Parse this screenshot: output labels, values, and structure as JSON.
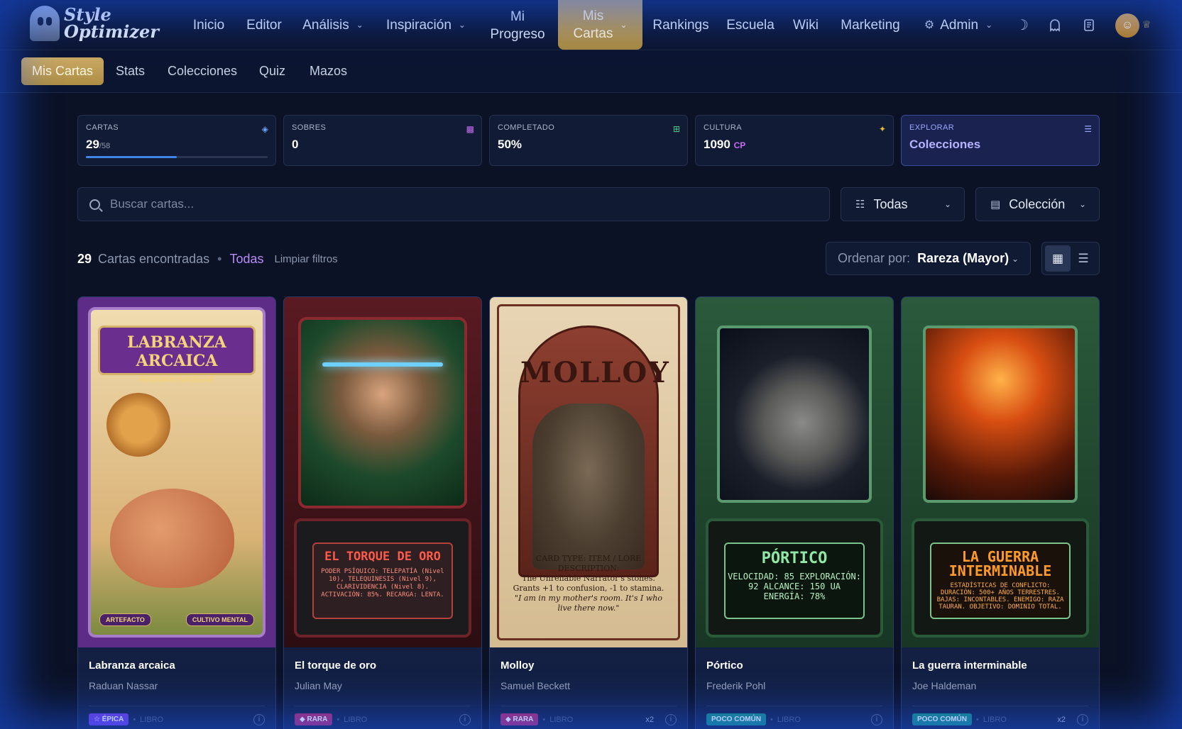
{
  "app": {
    "logo_line1": "Style",
    "logo_line2": "Optimizer"
  },
  "topnav": {
    "items": [
      "Inicio",
      "Editor",
      "Análisis",
      "Inspiración",
      "Mi Progreso",
      "Mis Cartas",
      "Rankings",
      "Escuela",
      "Wiki",
      "Marketing",
      "Admin"
    ],
    "mi_progreso_l1": "Mi",
    "mi_progreso_l2": "Progreso",
    "mis_cartas_l1": "Mis",
    "mis_cartas_l2": "Cartas",
    "icons": [
      "moon-icon",
      "ghost-icon",
      "notebook-icon",
      "user-icon",
      "crown-icon"
    ]
  },
  "subnav": {
    "items": [
      "Mis Cartas",
      "Stats",
      "Colecciones",
      "Quiz",
      "Mazos"
    ],
    "active": "Mis Cartas"
  },
  "stats": {
    "cartas": {
      "label": "CARTAS",
      "value": "29",
      "total": "/58",
      "progress": 0.5
    },
    "sobres": {
      "label": "SOBRES",
      "value": "0"
    },
    "completado": {
      "label": "COMPLETADO",
      "value": "50%"
    },
    "cultura": {
      "label": "CULTURA",
      "value": "1090",
      "unit": "CP"
    },
    "explorar": {
      "label": "EXPLORAR",
      "value": "Colecciones"
    }
  },
  "search": {
    "placeholder": "Buscar cartas..."
  },
  "filters": {
    "type": "Todas",
    "collection": "Colección"
  },
  "results": {
    "count": "29",
    "found_label": "Cartas encontradas",
    "active_filter": "Todas",
    "clear_label": "Limpiar filtros"
  },
  "sort": {
    "label": "Ordenar por:",
    "value": "Rareza (Mayor)"
  },
  "cards": [
    {
      "title": "Labranza arcaica",
      "author": "Raduan Nassar",
      "rarity": "ÉPICA",
      "kind": "LIBRO",
      "dup": "",
      "art_title": "LABRANZA ARCAICA",
      "art_author": "RADUAN NASSAR",
      "tag1": "ARTEFACTO",
      "tag2": "CULTIVO MENTAL"
    },
    {
      "title": "El torque de oro",
      "author": "Julian May",
      "rarity": "RARA",
      "kind": "LIBRO",
      "dup": "",
      "art_title": "EL TORQUE DE ORO",
      "art_desc": "PODER PSÍQUICO: TELEPATÍA (Nivel 10), TELEQUINESIS (Nivel 9), CLARIVIDENCIA (Nivel 8). ACTIVACIÓN: 85%. RECARGA: LENTA."
    },
    {
      "title": "Molloy",
      "author": "Samuel Beckett",
      "rarity": "RARA",
      "kind": "LIBRO",
      "dup": "x2",
      "art_title": "MOLLOY",
      "art_l1": "CARD TYPE: ITEM / LORE",
      "art_l2": "DESCRIPTION:",
      "art_l3": "The Unreliable Narrator's stones. Grants +1 to confusion, -1 to stamina.",
      "art_l4": "\"I am in my mother's room. It's I who live there now.\""
    },
    {
      "title": "Pórtico",
      "author": "Frederik Pohl",
      "rarity": "POCO COMÚN",
      "kind": "LIBRO",
      "dup": "",
      "art_title": "PÓRTICO",
      "art_desc": "VELOCIDAD: 85 EXPLORACIÓN: 92 ALCANCE: 150 UA ENERGÍA: 78%"
    },
    {
      "title": "La guerra interminable",
      "author": "Joe Haldeman",
      "rarity": "POCO COMÚN",
      "kind": "LIBRO",
      "dup": "x2",
      "art_title": "LA GUERRA INTERMINABLE",
      "art_desc": "ESTADÍSTICAS DE CONFLICTO: DURACIÓN: 500+ AÑOS TERRESTRES. BAJAS: INCONTABLES. ENEMIGO: RAZA TAURAN. OBJETIVO: DOMINIO TOTAL."
    }
  ],
  "colors": {
    "accent_gold": "#c9a862",
    "accent_purple": "#b68cf5",
    "epica": "#6d3bd8",
    "rara": "#b0286a",
    "poco_comun": "#168a7e"
  }
}
